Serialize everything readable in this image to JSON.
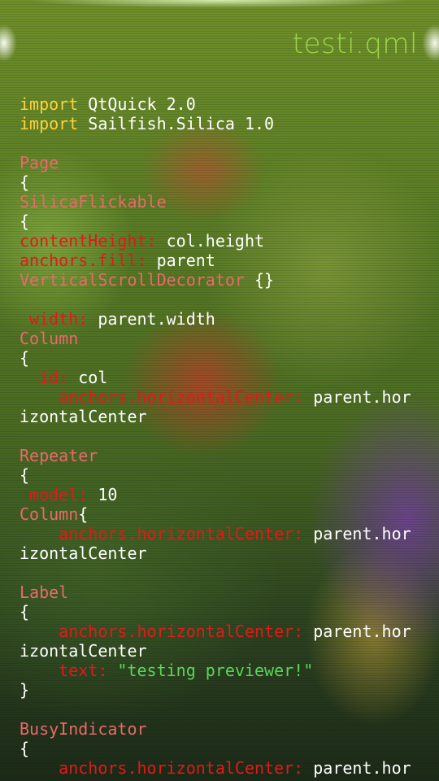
{
  "header": {
    "title": "testi.qml"
  },
  "code": {
    "lines": [
      [
        {
          "t": "import",
          "c": "kw"
        },
        {
          "t": " QtQuick 2.0",
          "c": "plain"
        }
      ],
      [
        {
          "t": "import",
          "c": "kw"
        },
        {
          "t": " Sailfish.Silica 1.0",
          "c": "plain"
        }
      ],
      [],
      [
        {
          "t": "Page",
          "c": "type"
        }
      ],
      [
        {
          "t": "{",
          "c": "plain"
        }
      ],
      [
        {
          "t": "SilicaFlickable",
          "c": "type"
        }
      ],
      [
        {
          "t": "{",
          "c": "plain"
        }
      ],
      [
        {
          "t": "contentHeight:",
          "c": "prop"
        },
        {
          "t": " col.height",
          "c": "plain"
        }
      ],
      [
        {
          "t": "anchors.fill:",
          "c": "prop"
        },
        {
          "t": " parent",
          "c": "plain"
        }
      ],
      [
        {
          "t": "VerticalScrollDecorator",
          "c": "type"
        },
        {
          "t": " {}",
          "c": "plain"
        }
      ],
      [],
      [
        {
          "t": " width:",
          "c": "prop"
        },
        {
          "t": " parent.width",
          "c": "plain"
        }
      ],
      [
        {
          "t": "Column",
          "c": "type"
        }
      ],
      [
        {
          "t": "{",
          "c": "plain"
        }
      ],
      [
        {
          "t": "  id:",
          "c": "prop"
        },
        {
          "t": " col",
          "c": "plain"
        }
      ],
      [
        {
          "t": "    anchors.horizontalCenter:",
          "c": "prop"
        },
        {
          "t": " parent.hor",
          "c": "plain"
        }
      ],
      [
        {
          "t": "izontalCenter",
          "c": "plain"
        }
      ],
      [],
      [
        {
          "t": "Repeater",
          "c": "type"
        }
      ],
      [
        {
          "t": "{",
          "c": "plain"
        }
      ],
      [
        {
          "t": " model:",
          "c": "prop"
        },
        {
          "t": " 10",
          "c": "plain"
        }
      ],
      [
        {
          "t": "Column",
          "c": "type"
        },
        {
          "t": "{",
          "c": "plain"
        }
      ],
      [
        {
          "t": "    anchors.horizontalCenter:",
          "c": "prop"
        },
        {
          "t": " parent.hor",
          "c": "plain"
        }
      ],
      [
        {
          "t": "izontalCenter",
          "c": "plain"
        }
      ],
      [],
      [
        {
          "t": "Label",
          "c": "type"
        }
      ],
      [
        {
          "t": "{",
          "c": "plain"
        }
      ],
      [
        {
          "t": "    anchors.horizontalCenter:",
          "c": "prop"
        },
        {
          "t": " parent.hor",
          "c": "plain"
        }
      ],
      [
        {
          "t": "izontalCenter",
          "c": "plain"
        }
      ],
      [
        {
          "t": "    text:",
          "c": "prop"
        },
        {
          "t": " \"testing previewer!\"",
          "c": "str"
        }
      ],
      [
        {
          "t": "}",
          "c": "plain"
        }
      ],
      [],
      [
        {
          "t": "BusyIndicator",
          "c": "type"
        }
      ],
      [
        {
          "t": "{",
          "c": "plain"
        }
      ],
      [
        {
          "t": "    anchors.horizontalCenter:",
          "c": "prop"
        },
        {
          "t": " parent.hor",
          "c": "plain"
        }
      ]
    ]
  }
}
